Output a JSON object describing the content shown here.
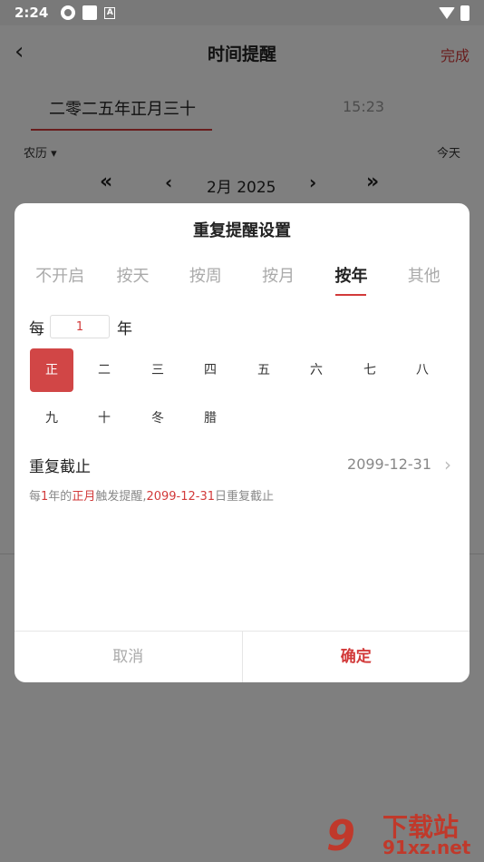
{
  "status_bar": {
    "time": "2:24",
    "notif_letter": "A"
  },
  "app_bar": {
    "title": "时间提醒",
    "done_label": "完成"
  },
  "top_tabs": {
    "lunar_date": "二零二五年正月三十",
    "time": "15:23"
  },
  "calendar": {
    "lunar_switch": "农历 ▾",
    "today": "今天",
    "month_label": "2月  2025"
  },
  "dialog": {
    "title": "重复提醒设置",
    "modes": [
      "不开启",
      "按天",
      "按周",
      "按月",
      "按年",
      "其他"
    ],
    "active_mode": "按年",
    "every_prefix": "每",
    "every_value": "1",
    "every_suffix": "年",
    "months": [
      "正",
      "二",
      "三",
      "四",
      "五",
      "六",
      "七",
      "八",
      "九",
      "十",
      "冬",
      "腊"
    ],
    "selected_month": "正",
    "until_label": "重复截止",
    "until_value": "2099-12-31",
    "summary": {
      "p1": "每",
      "n": "1",
      "p2": "年的",
      "month": "正月",
      "p3": "触发提醒,",
      "date": "2099-12-31",
      "p4": "日重复截止"
    },
    "cancel_label": "取消",
    "ok_label": "确定"
  },
  "watermark": {
    "logo": "9",
    "text": "下载站",
    "url": "91xz.net"
  },
  "colors": {
    "accent": "#d23a3a",
    "selected_bg": "#d14646",
    "overlay": "rgba(0,0,0,0.5)"
  }
}
